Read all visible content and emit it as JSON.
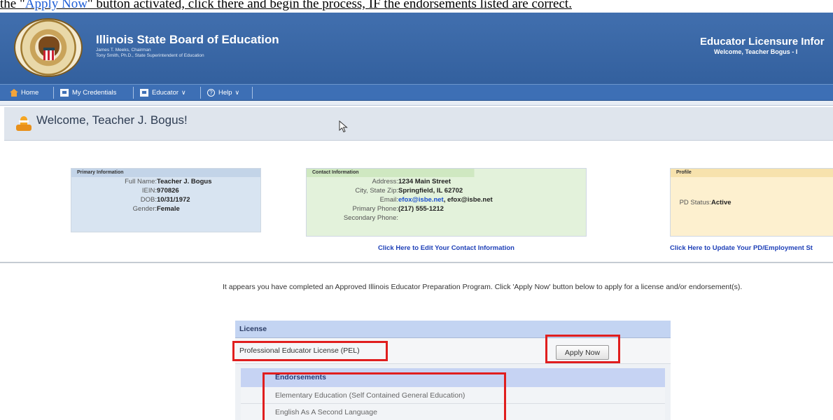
{
  "caption": {
    "prefix": "the \"",
    "link_text": "Apply Now",
    "suffix": "\" button activated, click there and begin the process, IF the endorsements listed are correct."
  },
  "header": {
    "org_title": "Illinois State Board of Education",
    "org_sub_1": "James T. Meeks, Chairman",
    "org_sub_2": "Tony Smith, Ph.D., State Superintendent of Education",
    "system_title": "Educator Licensure Infor",
    "system_welcome": "Welcome, Teacher Bogus - I",
    "brand_color": "#3c6aa8"
  },
  "nav": {
    "items": [
      {
        "label": "Home",
        "icon": "home-icon"
      },
      {
        "label": "My Credentials",
        "icon": "document-icon"
      },
      {
        "label": "Educator",
        "icon": "document-icon",
        "has_dropdown": true
      },
      {
        "label": "Help",
        "icon": "help-icon",
        "has_dropdown": true
      }
    ]
  },
  "welcome": {
    "text": "Welcome, Teacher J. Bogus!",
    "icon": "traffic-cone-icon"
  },
  "primary_info": {
    "title": "Primary Information",
    "full_name_label": "Full Name:",
    "full_name": "Teacher J. Bogus",
    "iein_label": "IEIN:",
    "iein": "970826",
    "dob_label": "DOB:",
    "dob": "10/31/1972",
    "gender_label": "Gender:",
    "gender": "Female"
  },
  "contact_info": {
    "title": "Contact Information",
    "address_label": "Address:",
    "address": "1234 Main Street",
    "city_label": "City, State Zip:",
    "city": "Springfield, IL 62702",
    "email_label": "Email:",
    "email_1": "efox@isbe.net",
    "email_sep": ", ",
    "email_2": "efox@isbe.net",
    "primary_phone_label": "Primary Phone:",
    "primary_phone": "(217) 555-1212",
    "secondary_phone_label": "Secondary Phone:",
    "edit_link": "Click Here to Edit Your Contact Information"
  },
  "profile": {
    "title": "Profile",
    "pd_status_label": "PD Status:",
    "pd_status": "Active",
    "update_link": "Click Here to Update Your PD/Employment St"
  },
  "main": {
    "info_text": "It appears you have completed an Approved Illinois Educator Preparation Program. Click 'Apply Now' button below to apply for a license and/or endorsement(s).",
    "license_header": "License",
    "license_name": "Professional Educator License (PEL)",
    "apply_button": "Apply Now",
    "endorsements_header": "Endorsements",
    "endorsements": [
      "Elementary Education (Self Contained General Education)",
      "English As A Second Language"
    ]
  },
  "highlight_color": "#e01e1e"
}
